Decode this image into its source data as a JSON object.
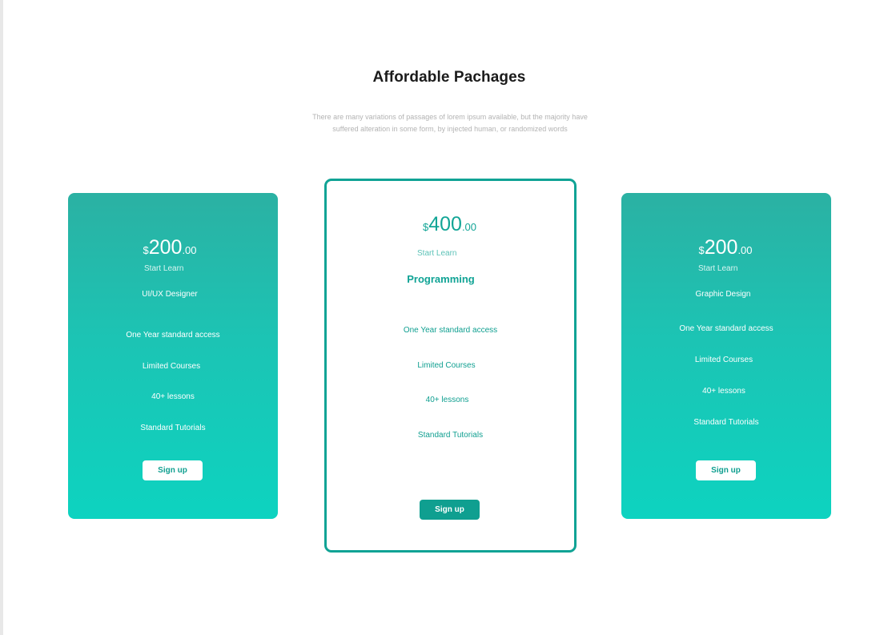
{
  "header": {
    "title": "Affordable Pachages",
    "subtitle_line1": "There are many variations of passages of lorem ipsum available, but the majority have",
    "subtitle_line2": "suffered alteration in some form, by injected human, or randomized words"
  },
  "plans": [
    {
      "currency": "$",
      "amount": "200",
      "cents": ".00",
      "tagline": "Start Learn",
      "name": "UI/UX Designer",
      "features": [
        "One Year standard access",
        "Limited Courses",
        "40+ lessons",
        "Standard Tutorials"
      ],
      "cta": "Sign up"
    },
    {
      "currency": "$",
      "amount": "400",
      "cents": ".00",
      "tagline": "Start Learn",
      "name": "Programming",
      "features": [
        "One Year standard access",
        "Limited Courses",
        "40+ lessons",
        "Standard Tutorials"
      ],
      "cta": "Sign up"
    },
    {
      "currency": "$",
      "amount": "200",
      "cents": ".00",
      "tagline": "Start Learn",
      "name": "Graphic Design",
      "features": [
        "One Year standard access",
        "Limited Courses",
        "40+ lessons",
        "Standard Tutorials"
      ],
      "cta": "Sign up"
    }
  ],
  "colors": {
    "accent": "#10a395",
    "gradient_top": "#2bb1a3",
    "gradient_bottom": "#0dd3c0",
    "title": "#1b1b1b",
    "subtitle": "#b3b3b3"
  }
}
